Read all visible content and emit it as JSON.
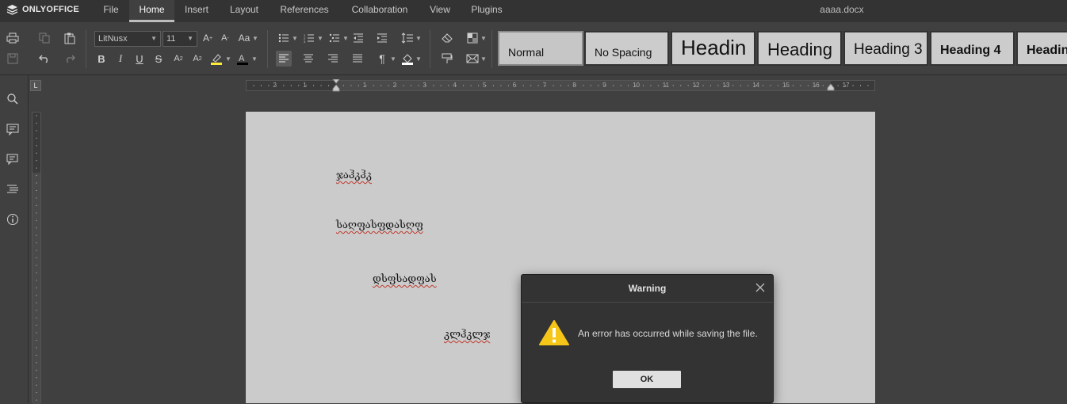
{
  "app": {
    "brand": "ONLYOFFICE",
    "document_title": "aaaa.docx"
  },
  "menu_tabs": [
    {
      "label": "File"
    },
    {
      "label": "Home"
    },
    {
      "label": "Insert"
    },
    {
      "label": "Layout"
    },
    {
      "label": "References"
    },
    {
      "label": "Collaboration"
    },
    {
      "label": "View"
    },
    {
      "label": "Plugins"
    }
  ],
  "active_tab": "Home",
  "font": {
    "family": "LitNusx",
    "size": "11"
  },
  "styles": [
    {
      "label": "Normal"
    },
    {
      "label": "No Spacing"
    },
    {
      "label": "Headin"
    },
    {
      "label": "Heading"
    },
    {
      "label": "Heading 3"
    },
    {
      "label": "Heading 4"
    },
    {
      "label": "Headin"
    }
  ],
  "ruler": {
    "numbers": [
      "2",
      "1",
      "1",
      "2",
      "3",
      "4",
      "5",
      "6",
      "7",
      "8",
      "9",
      "10",
      "11",
      "12",
      "13",
      "14",
      "15",
      "16",
      "17"
    ],
    "corner_symbol": "L"
  },
  "document": {
    "paragraphs": [
      "ჯაჰკჰკ",
      "საღფასფდასღფ",
      "დსფსადფას",
      "კლჰკლჯ"
    ]
  },
  "dialog": {
    "title": "Warning",
    "message": "An error has occurred while saving the file.",
    "ok_label": "OK"
  },
  "colors": {
    "accent_highlight": "#ffeb3b",
    "font_color": "#000000",
    "warning": "#f5c518"
  }
}
